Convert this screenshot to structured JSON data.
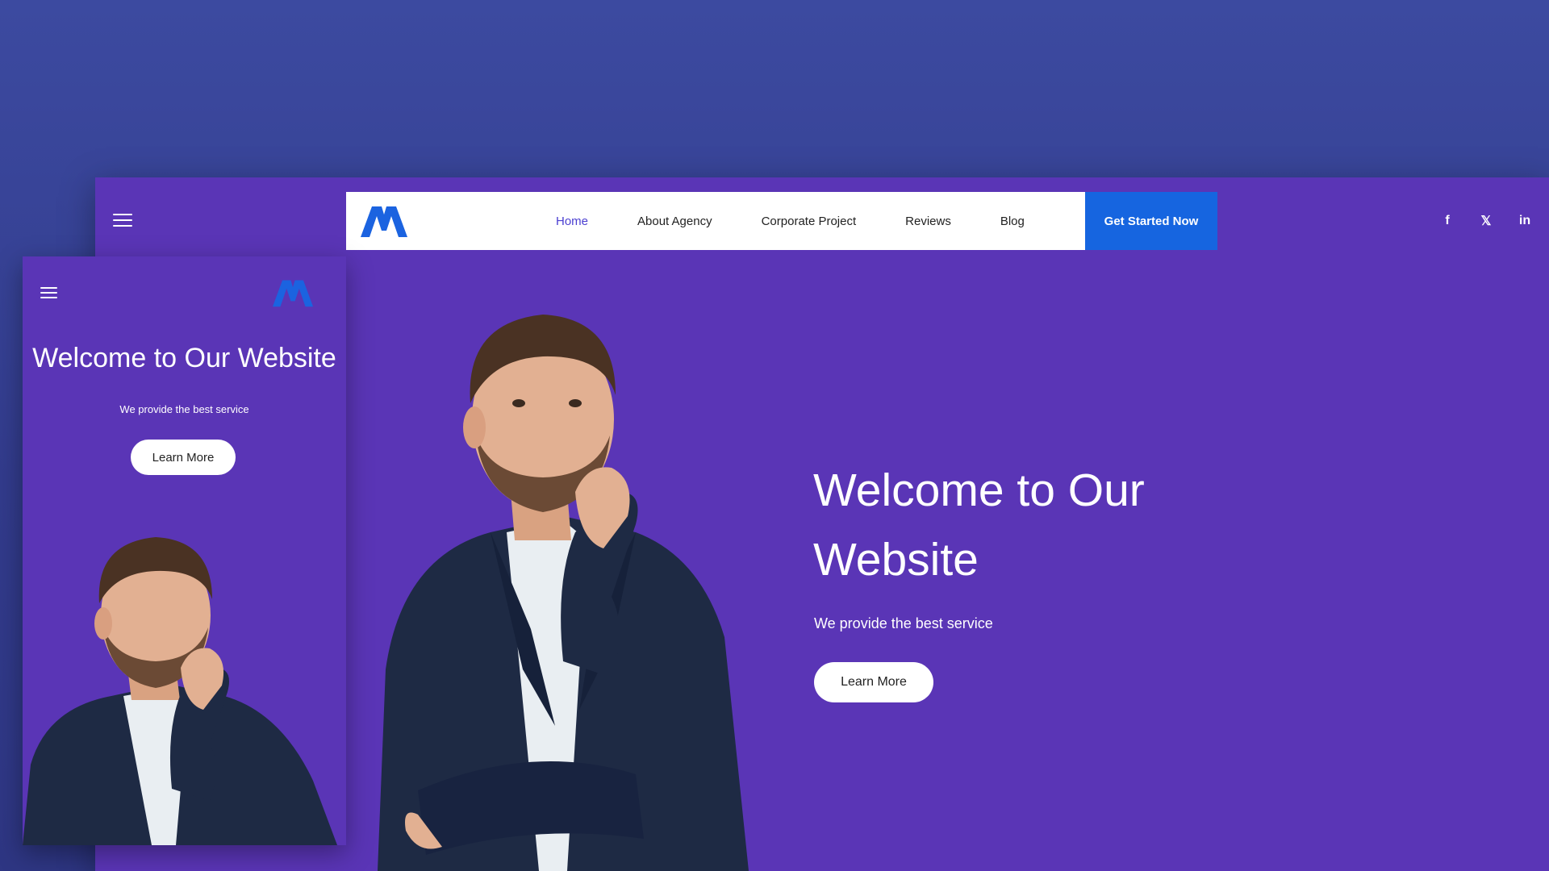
{
  "desktop": {
    "nav": {
      "items": [
        {
          "label": "Home",
          "active": true
        },
        {
          "label": "About Agency"
        },
        {
          "label": "Corporate Project"
        },
        {
          "label": "Reviews"
        },
        {
          "label": "Blog"
        }
      ],
      "cta_label": "Get Started Now"
    },
    "social": {
      "facebook": "f",
      "x": "𝕏",
      "linkedin": "in"
    },
    "hero": {
      "title": "Welcome to Our Website",
      "subtitle": "We provide the best service",
      "button_label": "Learn More"
    }
  },
  "mobile": {
    "hero": {
      "title": "Welcome to Our Website",
      "subtitle": "We provide the best service",
      "button_label": "Learn More"
    }
  },
  "colors": {
    "background": "#3c4aa0",
    "panel": "#5a35b6",
    "accent": "#1665e0",
    "active_nav": "#4b3fd1",
    "logo": "#1b63e0"
  },
  "icons": [
    "hamburger-icon",
    "logo-mark",
    "facebook-icon",
    "x-icon",
    "linkedin-icon"
  ]
}
